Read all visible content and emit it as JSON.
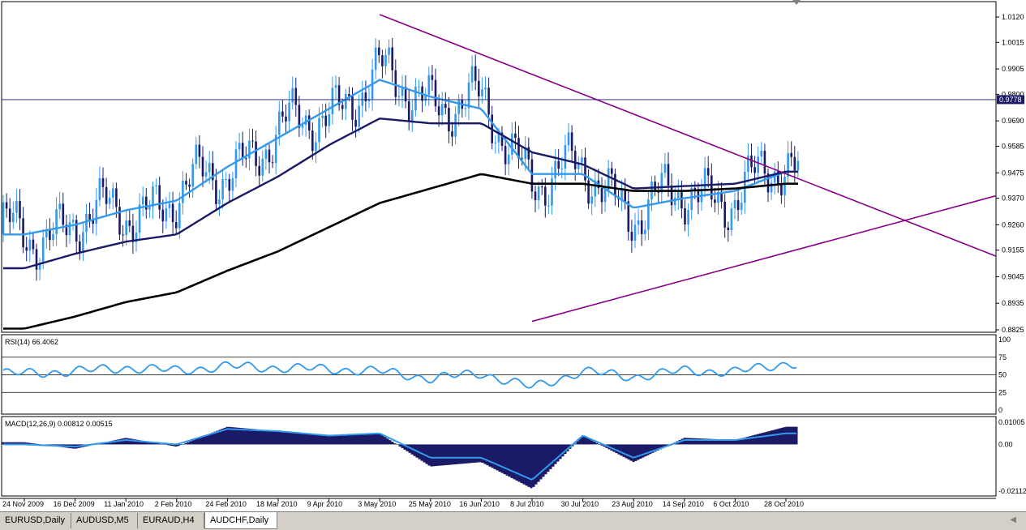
{
  "window": {
    "symbol": "AUDCHF",
    "timeframe": "Daily"
  },
  "tabs": [
    {
      "label": "EURUSD,Daily",
      "active": false
    },
    {
      "label": "AUDUSD,M5",
      "active": false
    },
    {
      "label": "EURAUD,H4",
      "active": false
    },
    {
      "label": "AUDCHF,Daily",
      "active": true
    }
  ],
  "icons": {
    "tab_scroll": "chevron-left-icon",
    "shift_marker": "shift-triangle-icon"
  },
  "colors": {
    "background": "#ffffff",
    "candle": "#3399ee",
    "ma_fast": "#3399ee",
    "ma_mid": "#1a1a66",
    "ma_slow": "#000000",
    "trendline": "#880088",
    "rsi": "#3399ee",
    "macd_hist": "#1a1a66",
    "macd_signal": "#3399ee",
    "current_price_bg": "#1a1a66"
  },
  "chart_data": [
    {
      "type": "candlestick",
      "panel": "price",
      "current_price": "0.9778",
      "y_ticks": [
        "1.0120",
        "1.0015",
        "0.9905",
        "0.9800",
        "0.9690",
        "0.9585",
        "0.9475",
        "0.9370",
        "0.9260",
        "0.9155",
        "0.9045",
        "0.8935",
        "0.8825"
      ],
      "ylim": [
        0.8825,
        1.012
      ],
      "x_ticks": [
        "24 Nov 2009",
        "16 Dec 2009",
        "11 Jan 2010",
        "2 Feb 2010",
        "24 Feb 2010",
        "18 Mar 2010",
        "9 Apr 2010",
        "3 May 2010",
        "25 May 2010",
        "16 Jun 2010",
        "8 Jul 2010",
        "30 Jul 2010",
        "23 Aug 2010",
        "14 Sep 2010",
        "6 Oct 2010",
        "28 Oct 2010"
      ],
      "moving_averages": [
        {
          "color": "#3399ee",
          "points": [
            [
              "24 Nov 2009",
              0.922
            ],
            [
              "16 Dec 2009",
              0.926
            ],
            [
              "11 Jan 2010",
              0.932
            ],
            [
              "2 Feb 2010",
              0.936
            ],
            [
              "24 Feb 2010",
              0.95
            ],
            [
              "18 Mar 2010",
              0.962
            ],
            [
              "9 Apr 2010",
              0.974
            ],
            [
              "3 May 2010",
              0.986
            ],
            [
              "25 May 2010",
              0.979
            ],
            [
              "16 Jun 2010",
              0.974
            ],
            [
              "8 Jul 2010",
              0.947
            ],
            [
              "30 Jul 2010",
              0.947
            ],
            [
              "23 Aug 2010",
              0.933
            ],
            [
              "14 Sep 2010",
              0.937
            ],
            [
              "6 Oct 2010",
              0.94
            ],
            [
              "28 Oct 2010",
              0.948
            ]
          ]
        },
        {
          "color": "#1a1a66",
          "points": [
            [
              "24 Nov 2009",
              0.908
            ],
            [
              "16 Dec 2009",
              0.914
            ],
            [
              "11 Jan 2010",
              0.919
            ],
            [
              "2 Feb 2010",
              0.922
            ],
            [
              "24 Feb 2010",
              0.935
            ],
            [
              "18 Mar 2010",
              0.946
            ],
            [
              "9 Apr 2010",
              0.959
            ],
            [
              "3 May 2010",
              0.97
            ],
            [
              "25 May 2010",
              0.968
            ],
            [
              "16 Jun 2010",
              0.968
            ],
            [
              "8 Jul 2010",
              0.956
            ],
            [
              "30 Jul 2010",
              0.951
            ],
            [
              "23 Aug 2010",
              0.941
            ],
            [
              "14 Sep 2010",
              0.942
            ],
            [
              "6 Oct 2010",
              0.943
            ],
            [
              "28 Oct 2010",
              0.948
            ]
          ]
        },
        {
          "color": "#000000",
          "points": [
            [
              "24 Nov 2009",
              0.883
            ],
            [
              "16 Dec 2009",
              0.888
            ],
            [
              "11 Jan 2010",
              0.894
            ],
            [
              "2 Feb 2010",
              0.898
            ],
            [
              "24 Feb 2010",
              0.907
            ],
            [
              "18 Mar 2010",
              0.915
            ],
            [
              "9 Apr 2010",
              0.925
            ],
            [
              "3 May 2010",
              0.935
            ],
            [
              "25 May 2010",
              0.941
            ],
            [
              "16 Jun 2010",
              0.947
            ],
            [
              "8 Jul 2010",
              0.943
            ],
            [
              "30 Jul 2010",
              0.943
            ],
            [
              "23 Aug 2010",
              0.94
            ],
            [
              "14 Sep 2010",
              0.94
            ],
            [
              "6 Oct 2010",
              0.941
            ],
            [
              "28 Oct 2010",
              0.943
            ]
          ]
        }
      ],
      "trendlines": [
        {
          "from": [
            "3 May 2010",
            1.013
          ],
          "to": [
            "end",
            0.913
          ]
        },
        {
          "from": [
            "8 Jul 2010",
            0.886
          ],
          "to": [
            "end",
            0.938
          ]
        }
      ]
    },
    {
      "type": "line",
      "panel": "rsi",
      "title": "RSI(14) 66.4062",
      "ylim": [
        0,
        100
      ],
      "y_ticks": [
        "100",
        "75",
        "50",
        "25",
        "0"
      ],
      "levels": [
        75,
        50,
        25
      ],
      "x": [
        "24 Nov 2009",
        "16 Dec 2009",
        "11 Jan 2010",
        "2 Feb 2010",
        "24 Feb 2010",
        "18 Mar 2010",
        "9 Apr 2010",
        "3 May 2010",
        "25 May 2010",
        "16 Jun 2010",
        "8 Jul 2010",
        "30 Jul 2010",
        "23 Aug 2010",
        "14 Sep 2010",
        "6 Oct 2010",
        "28 Oct 2010"
      ],
      "values": [
        52,
        55,
        60,
        56,
        62,
        60,
        58,
        55,
        45,
        52,
        32,
        55,
        47,
        56,
        54,
        66
      ]
    },
    {
      "type": "bar",
      "panel": "macd",
      "title": "MACD(12,26,9) 0.00812 0.00515",
      "ylim": [
        -0.02112,
        0.01005
      ],
      "y_ticks": [
        "0.01005",
        "0.00",
        "-0.02112"
      ],
      "x": [
        "24 Nov 2009",
        "16 Dec 2009",
        "11 Jan 2010",
        "2 Feb 2010",
        "24 Feb 2010",
        "18 Mar 2010",
        "9 Apr 2010",
        "3 May 2010",
        "25 May 2010",
        "16 Jun 2010",
        "8 Jul 2010",
        "30 Jul 2010",
        "23 Aug 2010",
        "14 Sep 2010",
        "6 Oct 2010",
        "28 Oct 2010"
      ],
      "histogram": [
        0.001,
        -0.002,
        0.003,
        -0.001,
        0.008,
        0.006,
        0.004,
        0.005,
        -0.01,
        -0.008,
        -0.02,
        0.004,
        -0.008,
        0.003,
        0.002,
        0.008
      ],
      "signal": [
        0.0,
        -0.001,
        0.002,
        0.0,
        0.007,
        0.006,
        0.004,
        0.005,
        -0.006,
        -0.006,
        -0.016,
        0.004,
        -0.006,
        0.002,
        0.002,
        0.005
      ]
    }
  ]
}
